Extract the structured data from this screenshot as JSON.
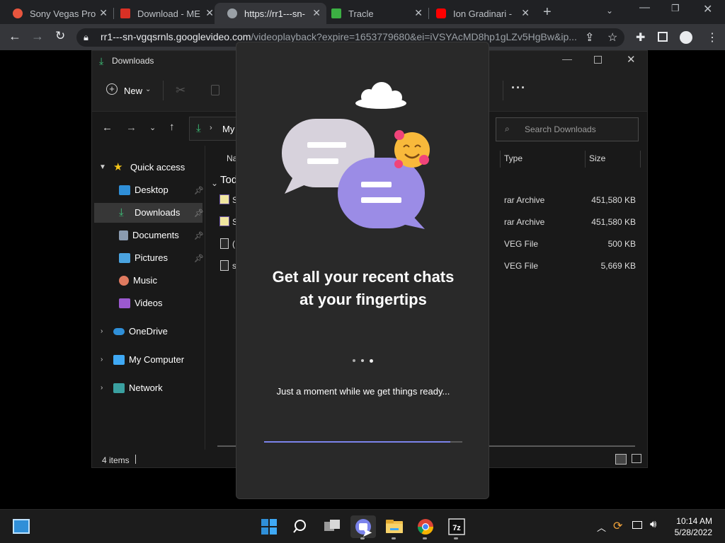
{
  "browser": {
    "tabs": [
      {
        "label": "Sony Vegas Pro",
        "favicon_color": "#e8553e"
      },
      {
        "label": "Download - ME",
        "favicon_color": "#d93025"
      },
      {
        "label": "https://rr1---sn-",
        "favicon_color": "#9aa0a6"
      },
      {
        "label": "Tracle",
        "favicon_color": "#3cb043"
      },
      {
        "label": "Ion Gradinari - ",
        "favicon_color": "#ff0000"
      }
    ],
    "url_host": "rr1---sn-vgqsrnls.googlevideo.com",
    "url_path": "/videoplayback?expire=1653779680&ei=iVSYAcMD8hp1gLZv5HgBw&ip..."
  },
  "explorer": {
    "title": "Downloads",
    "ribbon": {
      "new_label": "New"
    },
    "breadcrumb": "My",
    "search_placeholder": "Search Downloads",
    "columns": {
      "name": "Na",
      "type": "Type",
      "size": "Size"
    },
    "group_header": "Tod",
    "files": [
      {
        "name": "S",
        "type": "rar Archive",
        "size": "451,580 KB"
      },
      {
        "name": "S",
        "type": "rar Archive",
        "size": "451,580 KB"
      },
      {
        "name": "(",
        "type": "VEG File",
        "size": "500 KB"
      },
      {
        "name": "s",
        "type": "VEG File",
        "size": "5,669 KB"
      }
    ],
    "nav": {
      "quick_access": "Quick access",
      "desktop": "Desktop",
      "downloads": "Downloads",
      "documents": "Documents",
      "pictures": "Pictures",
      "music": "Music",
      "videos": "Videos",
      "onedrive": "OneDrive",
      "my_computer": "My Computer",
      "network": "Network"
    },
    "status": "4 items"
  },
  "dialog": {
    "headline_line1": "Get all your recent chats",
    "headline_line2": "at your fingertips",
    "subtext": "Just a moment while we get things ready...",
    "progress": 0.94
  },
  "taskbar": {
    "time": "10:14 AM",
    "date": "5/28/2022"
  },
  "colors": {
    "accent": "#7b83eb",
    "bubble_left": "#d7d2dc",
    "bubble_right": "#9b8ce6",
    "download_green": "#3ec47a"
  }
}
